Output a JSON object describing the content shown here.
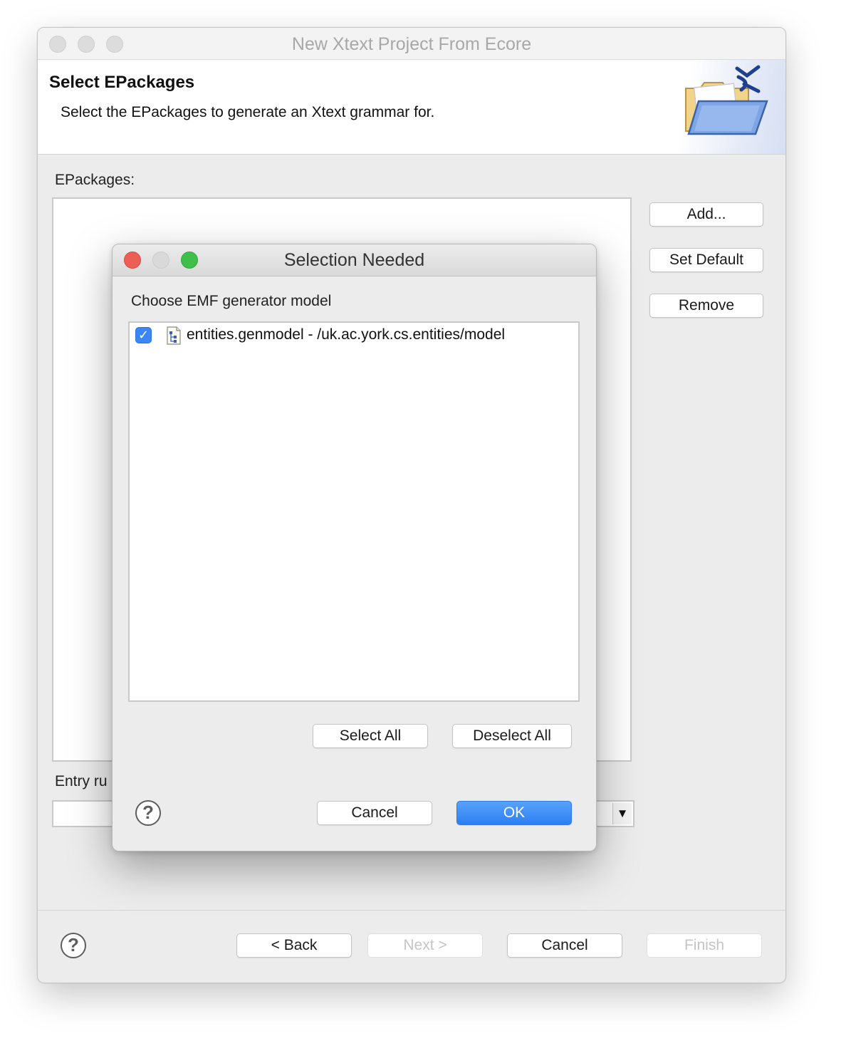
{
  "wizard": {
    "title": "New Xtext Project From Ecore",
    "header_title": "Select EPackages",
    "header_subtitle": "Select the EPackages to generate an Xtext grammar for.",
    "banner_icon": "folder-xtext-icon",
    "epackages_label": "EPackages:",
    "add_label": "Add...",
    "set_default_label": "Set Default",
    "remove_label": "Remove",
    "entry_rule_label": "Entry ru",
    "help_icon": "help-icon",
    "back_label": "< Back",
    "next_label": "Next >",
    "cancel_label": "Cancel",
    "finish_label": "Finish"
  },
  "dialog": {
    "title": "Selection Needed",
    "prompt": "Choose EMF generator model",
    "items": [
      {
        "label": "entities.genmodel - /uk.ac.york.cs.entities/model",
        "checked": true,
        "icon": "genmodel-icon"
      }
    ],
    "select_all_label": "Select All",
    "deselect_all_label": "Deselect All",
    "cancel_label": "Cancel",
    "ok_label": "OK"
  },
  "colors": {
    "accent": "#2c7ff4",
    "close": "#ec5f57",
    "zoom": "#3fbf4a"
  }
}
